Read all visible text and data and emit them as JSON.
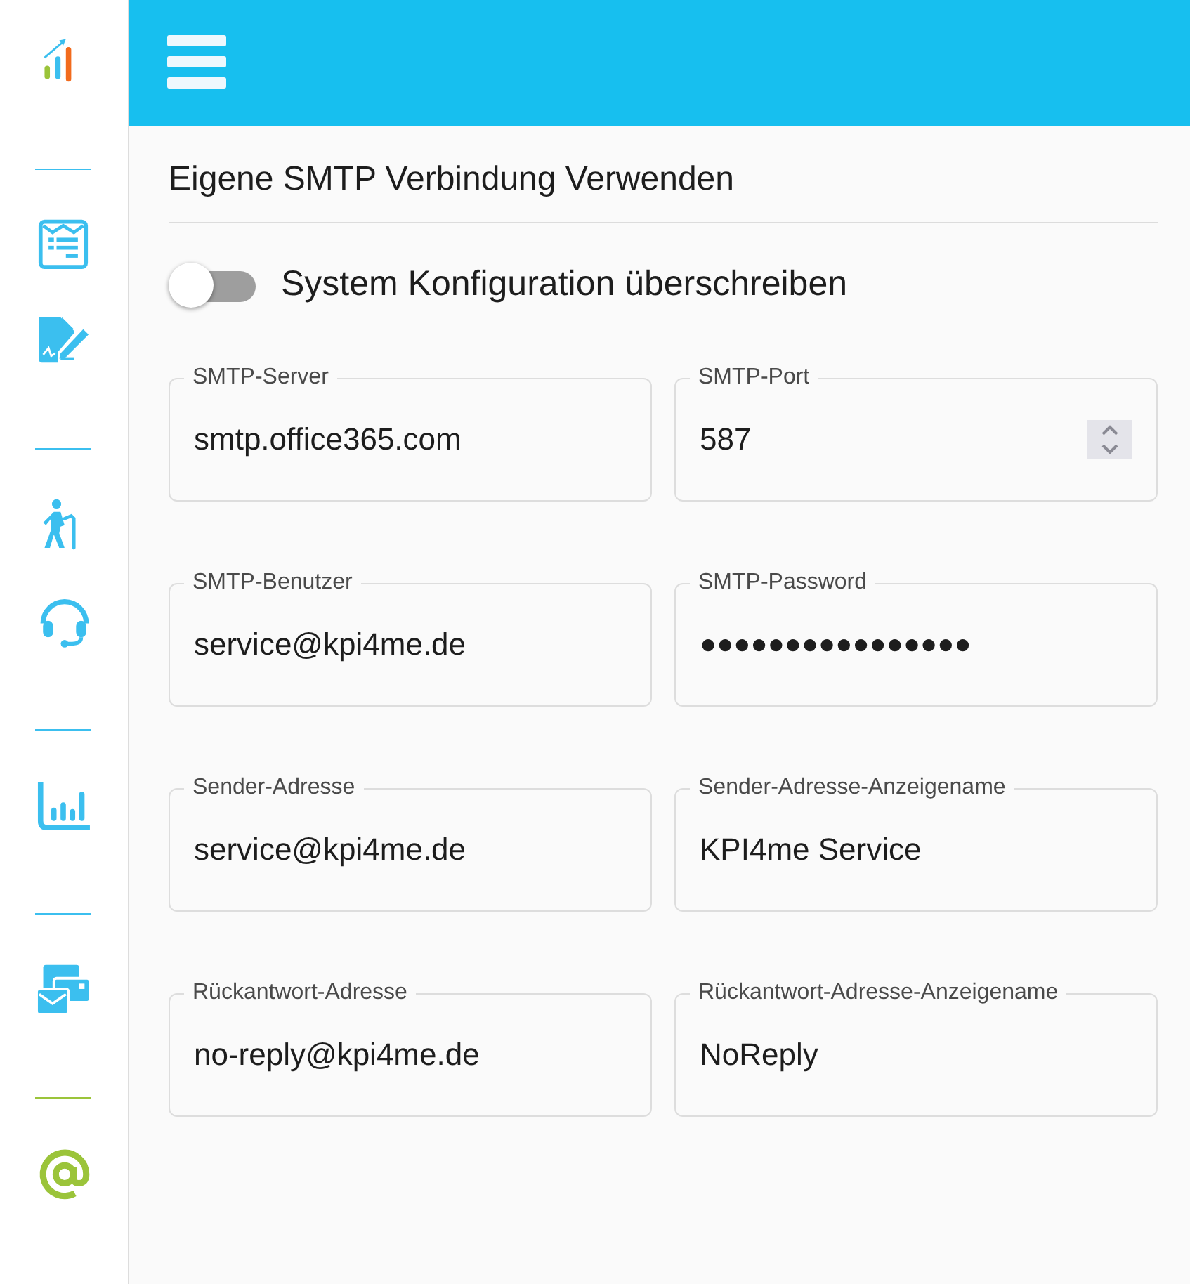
{
  "section": {
    "title": "Eigene SMTP Verbindung Verwenden"
  },
  "toggle": {
    "label": "System Konfiguration überschreiben",
    "on": false
  },
  "fields": [
    {
      "label": "SMTP-Server",
      "value": "smtp.office365.com",
      "kind": "text"
    },
    {
      "label": "SMTP-Port",
      "value": "587",
      "kind": "number"
    },
    {
      "label": "SMTP-Benutzer",
      "value": "service@kpi4me.de",
      "kind": "text"
    },
    {
      "label": "SMTP-Password",
      "value": "●●●●●●●●●●●●●●●●",
      "kind": "password"
    },
    {
      "label": "Sender-Adresse",
      "value": "service@kpi4me.de",
      "kind": "text"
    },
    {
      "label": "Sender-Adresse-Anzeigename",
      "value": "KPI4me Service",
      "kind": "text"
    },
    {
      "label": "Rückantwort-Adresse",
      "value": "no-reply@kpi4me.de",
      "kind": "text"
    },
    {
      "label": "Rückantwort-Adresse-Anzeigename",
      "value": "NoReply",
      "kind": "text"
    }
  ]
}
